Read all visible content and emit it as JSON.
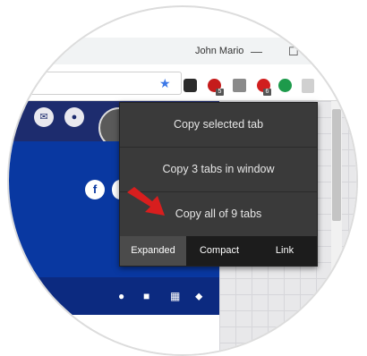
{
  "window": {
    "user_name": "John Mario",
    "minimize": "—",
    "maximize": "☐"
  },
  "toolbar": {
    "ext_adblock_badge": "5",
    "ext_download_badge": "6"
  },
  "popup": {
    "items": [
      {
        "label": "Copy selected tab"
      },
      {
        "label": "Copy 3 tabs in window"
      },
      {
        "label": "Copy all of 9 tabs"
      }
    ],
    "tabs": [
      {
        "label": "Expanded",
        "active": true
      },
      {
        "label": "Compact",
        "active": false
      },
      {
        "label": "Link",
        "active": false
      }
    ]
  },
  "page": {
    "facebook_letter": "f"
  },
  "colors": {
    "accent_blue": "#0938a1",
    "popup_bg": "#3a3a3a",
    "arrow_red": "#d81e1e"
  }
}
